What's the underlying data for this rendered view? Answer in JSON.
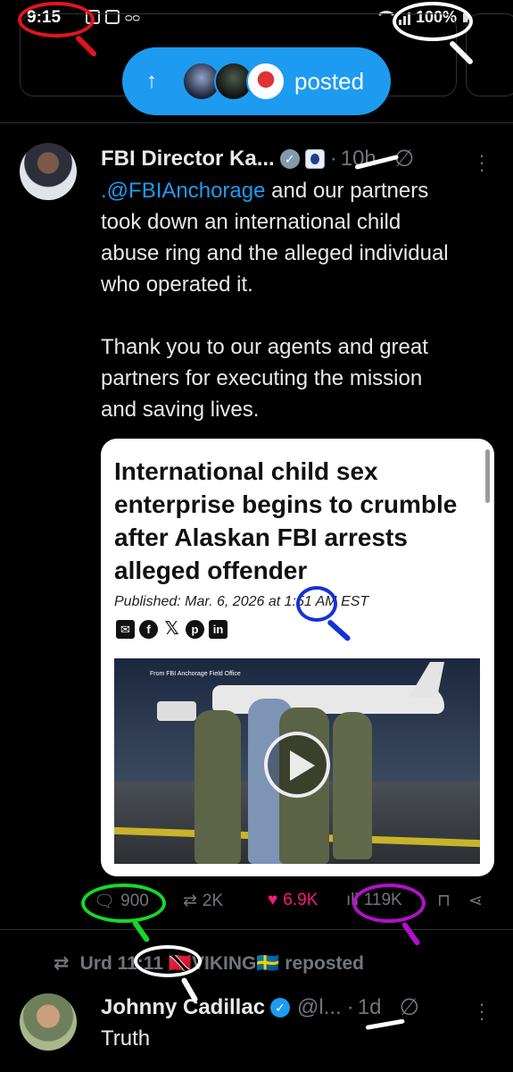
{
  "status_bar": {
    "time": "9:15",
    "battery": "100%"
  },
  "pill": {
    "label": "posted"
  },
  "tweet": {
    "author_name": "FBI Director Ka...",
    "time": "10h",
    "text_mention": ".@FBIAnchorage",
    "text_line1_rest": " and our partners",
    "text_lines": [
      "took down an international child",
      "abuse ring and the alleged individual",
      "who operated it."
    ],
    "text_para2": [
      "Thank you to our agents and great",
      "partners for executing the mission",
      "and saving lives."
    ],
    "card": {
      "headline": "International child sex enterprise begins to crumble after Alaskan FBI arrests alleged offender",
      "published": "Published: Mar. 6, 2026 at 1:51 AM EST",
      "photo_caption": "From FBI Anchorage Field Office"
    },
    "actions": {
      "replies": "900",
      "reposts": "2K",
      "likes": "6.9K",
      "views": "119K"
    }
  },
  "repost": {
    "text": "Urd 11:11 🇹🇹VIKING🇸🇪 reposted"
  },
  "tweet2": {
    "author_name": "Johnny Cadillac",
    "handle": "@l...",
    "time": "1d",
    "text": "Truth"
  },
  "colors": {
    "accent": "#1d9bf0",
    "like": "#f91880",
    "background": "#000000",
    "annotation_red": "#e3141e",
    "annotation_blue": "#1433d6",
    "annotation_green": "#19d62a",
    "annotation_magenta": "#b012c9",
    "annotation_white": "#ffffff"
  }
}
